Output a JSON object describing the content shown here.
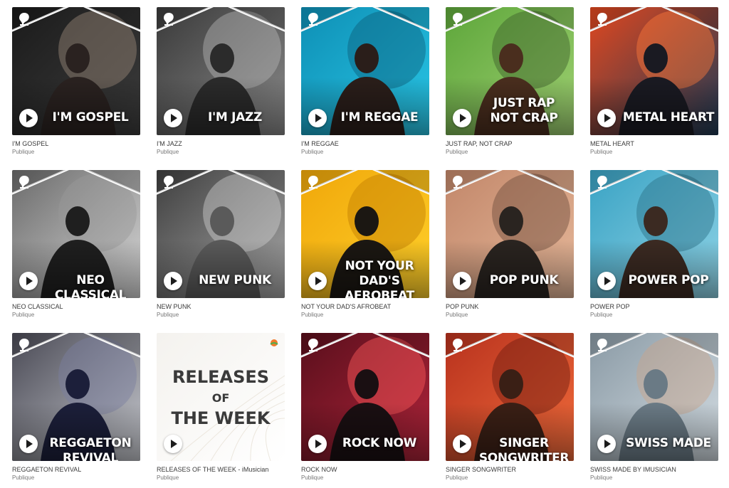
{
  "colors": {
    "background": "#ffffff",
    "name_text": "#3a3a3a",
    "meta_text": "#777777"
  },
  "playlists": [
    {
      "cover_title": "I'M GOSPEL",
      "name": "I'M GOSPEL",
      "visibility": "Publique",
      "theme": [
        "#1b1b1b",
        "#3c3c3c"
      ],
      "accent": "#9c8a7a",
      "figure": "#2a2220"
    },
    {
      "cover_title": "I'M JAZZ",
      "name": "I'M JAZZ",
      "visibility": "Publique",
      "theme": [
        "#3a3a3a",
        "#8a8a8a"
      ],
      "accent": "#b5b5b5",
      "figure": "#2b2b2b"
    },
    {
      "cover_title": "I'M REGGAE",
      "name": "I'M REGGAE",
      "visibility": "Publique",
      "theme": [
        "#0e8fb5",
        "#29c6e6"
      ],
      "accent": "#0a5e7a",
      "figure": "#2a1e1a"
    },
    {
      "cover_title": "JUST RAP\nNOT CRAP",
      "name": "JUST RAP, NOT CRAP",
      "visibility": "Publique",
      "theme": [
        "#5da63a",
        "#9fd072"
      ],
      "accent": "#3b5e2b",
      "figure": "#4a2e1e"
    },
    {
      "cover_title": "METAL HEART",
      "name": "METAL HEART",
      "visibility": "Publique",
      "theme": [
        "#e0471f",
        "#1e3a55"
      ],
      "accent": "#ff7a3a",
      "figure": "#1a1a22"
    },
    {
      "cover_title": "NEO CLASSICAL",
      "name": "NEO CLASSICAL",
      "visibility": "Publique",
      "theme": [
        "#6b6b6b",
        "#d8d8d8"
      ],
      "accent": "#9a9a9a",
      "figure": "#1f1f1f"
    },
    {
      "cover_title": "NEW PUNK",
      "name": "NEW PUNK",
      "visibility": "Publique",
      "theme": [
        "#3f3f3f",
        "#a8a8a8"
      ],
      "accent": "#d0d0d0",
      "figure": "#5a5a5a"
    },
    {
      "cover_title": "NOT YOUR DAD'S\nAFROBEAT",
      "name": "NOT YOUR DAD'S AFROBEAT",
      "visibility": "Publique",
      "theme": [
        "#f0a70a",
        "#ffd02a"
      ],
      "accent": "#c07d00",
      "figure": "#1b1712"
    },
    {
      "cover_title": "POP PUNK",
      "name": "POP PUNK",
      "visibility": "Publique",
      "theme": [
        "#c2876a",
        "#e6b89a"
      ],
      "accent": "#6b4a3a",
      "figure": "#2a2420"
    },
    {
      "cover_title": "POWER POP",
      "name": "POWER POP",
      "visibility": "Publique",
      "theme": [
        "#3aa3c4",
        "#8fd3e6"
      ],
      "accent": "#2a6e85",
      "figure": "#3b2a22"
    },
    {
      "cover_title": "REGGAETON REVIVAL",
      "name": "REGGAETON REVIVAL",
      "visibility": "Publique",
      "theme": [
        "#4a4a55",
        "#c7c9cf"
      ],
      "accent": "#7a7ea0",
      "figure": "#1c1f3a"
    },
    {
      "cover_title": "",
      "name": "RELEASES OF THE WEEK - iMusician",
      "visibility": "Publique",
      "theme": [
        "#f4f2ee",
        "#ffffff"
      ],
      "accent": "#e8e3da",
      "figure": "#ffffff"
    },
    {
      "cover_title": "ROCK NOW",
      "name": "ROCK NOW",
      "visibility": "Publique",
      "theme": [
        "#5a0f1c",
        "#b0243a"
      ],
      "accent": "#ff5a5a",
      "figure": "#1a0f12"
    },
    {
      "cover_title": "SINGER SONGWRITER",
      "name": "SINGER SONGWRITER",
      "visibility": "Publique",
      "theme": [
        "#b8321e",
        "#ef6a3a"
      ],
      "accent": "#6a1a10",
      "figure": "#3a1f15"
    },
    {
      "cover_title": "SWISS MADE",
      "name": "SWISS MADE BY IMUSICIAN",
      "visibility": "Publique",
      "theme": [
        "#8a9aa5",
        "#d4dde3"
      ],
      "accent": "#c9a48a",
      "figure": "#6a7a85"
    }
  ],
  "releases": {
    "line1": "RELEASES",
    "line2": "OF",
    "line3": "THE WEEK"
  }
}
